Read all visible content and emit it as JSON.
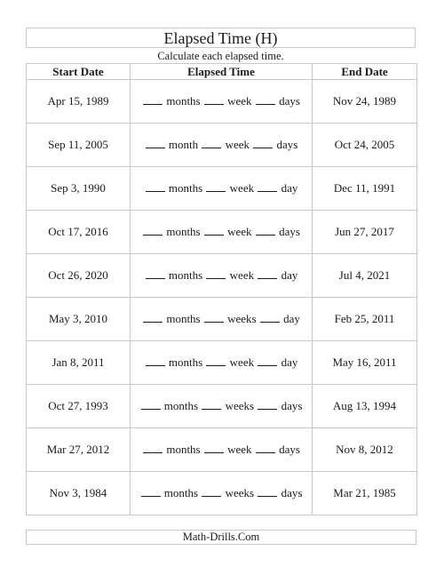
{
  "header": {
    "title": "Elapsed Time (H)",
    "instructions": "Calculate each elapsed time."
  },
  "table": {
    "columns": [
      "Start Date",
      "Elapsed Time",
      "End Date"
    ],
    "rows": [
      {
        "start": "Apr 15, 1989",
        "u1": "months",
        "u2": "week",
        "u3": "days",
        "end": "Nov 24, 1989"
      },
      {
        "start": "Sep 11, 2005",
        "u1": "month",
        "u2": "week",
        "u3": "days",
        "end": "Oct 24, 2005"
      },
      {
        "start": "Sep 3, 1990",
        "u1": "months",
        "u2": "week",
        "u3": "day",
        "end": "Dec 11, 1991"
      },
      {
        "start": "Oct 17, 2016",
        "u1": "months",
        "u2": "week",
        "u3": "days",
        "end": "Jun 27, 2017"
      },
      {
        "start": "Oct 26, 2020",
        "u1": "months",
        "u2": "week",
        "u3": "day",
        "end": "Jul 4, 2021"
      },
      {
        "start": "May 3, 2010",
        "u1": "months",
        "u2": "weeks",
        "u3": "day",
        "end": "Feb 25, 2011"
      },
      {
        "start": "Jan 8, 2011",
        "u1": "months",
        "u2": "week",
        "u3": "day",
        "end": "May 16, 2011"
      },
      {
        "start": "Oct 27, 1993",
        "u1": "months",
        "u2": "weeks",
        "u3": "days",
        "end": "Aug 13, 1994"
      },
      {
        "start": "Mar 27, 2012",
        "u1": "months",
        "u2": "week",
        "u3": "days",
        "end": "Nov 8, 2012"
      },
      {
        "start": "Nov 3, 1984",
        "u1": "months",
        "u2": "weeks",
        "u3": "days",
        "end": "Mar 21, 1985"
      }
    ]
  },
  "footer": {
    "text": "Math-Drills.Com"
  }
}
